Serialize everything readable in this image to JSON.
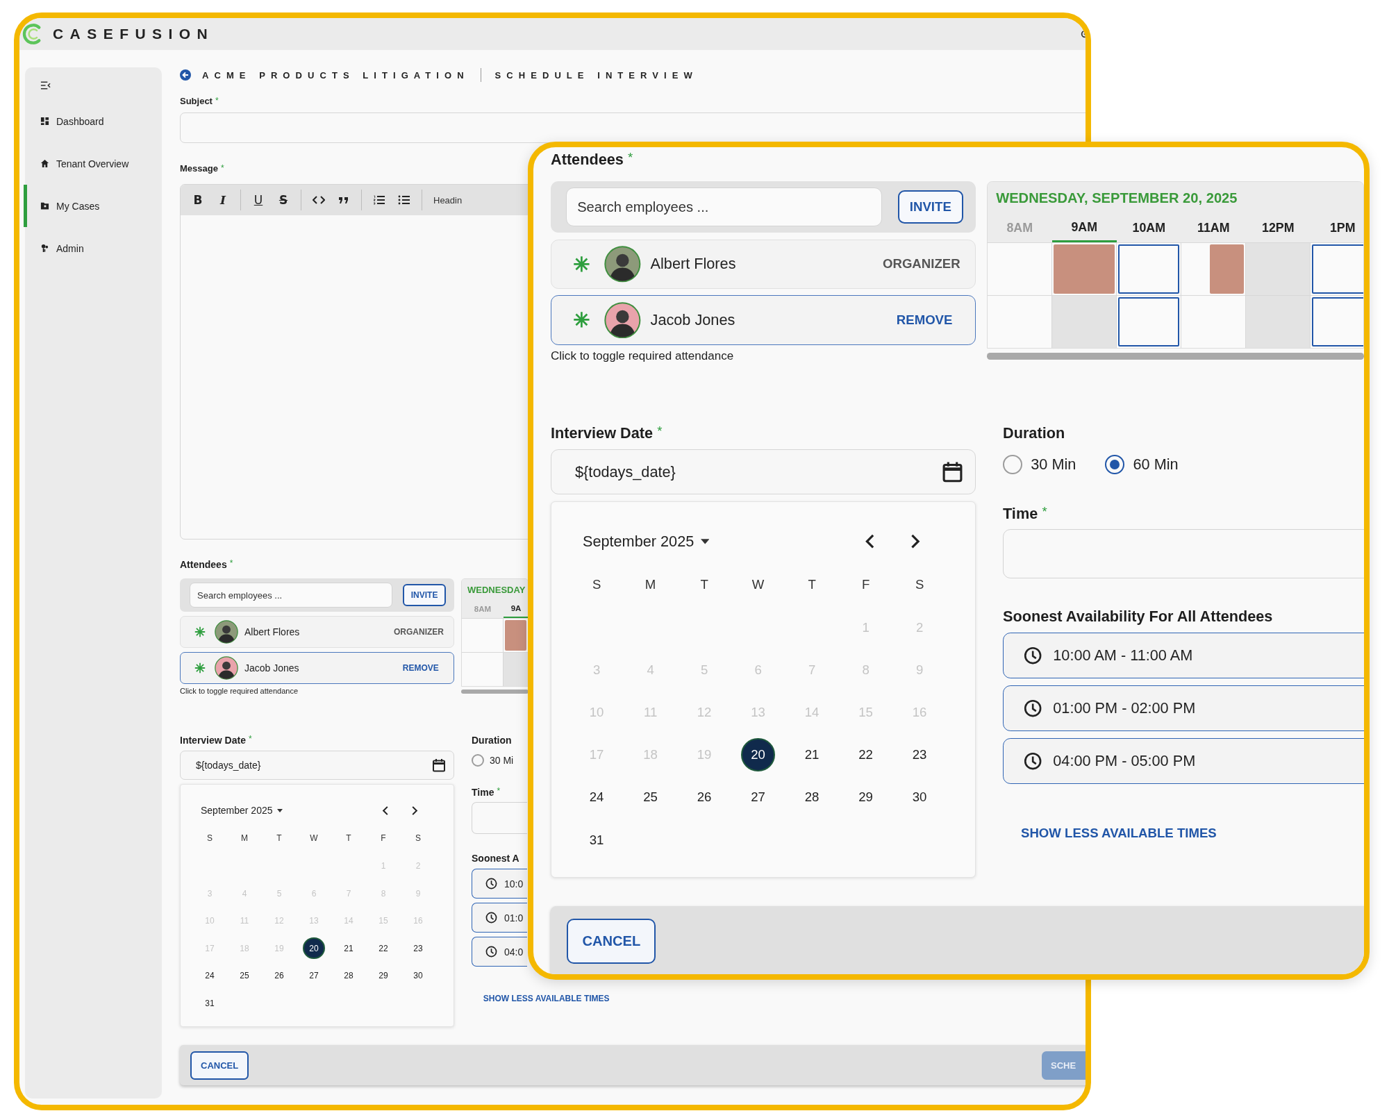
{
  "main_screen": {
    "brand": "CASEFUSION",
    "sidebar": {
      "items": [
        {
          "label": "Dashboard",
          "kind": "dashboard",
          "selected": false
        },
        {
          "label": "Tenant Overview",
          "kind": "home",
          "selected": false
        },
        {
          "label": "My Cases",
          "kind": "folder",
          "selected": true
        },
        {
          "label": "Admin",
          "kind": "admin",
          "selected": false
        }
      ]
    },
    "breadcrumb": [
      "ACME PRODUCTS LITIGATION",
      "SCHEDULE INTERVIEW"
    ],
    "subject": {
      "label": "Subject",
      "required_mark": "*"
    },
    "message": {
      "label": "Message",
      "required_mark": "*",
      "toolbar": [
        [
          {
            "kind": "bold",
            "label": "B"
          },
          {
            "kind": "italic",
            "label": "I"
          }
        ],
        [
          {
            "kind": "underline",
            "label": "U"
          },
          {
            "kind": "strike",
            "label": "S"
          }
        ],
        [
          {
            "kind": "code"
          },
          {
            "kind": "quote"
          }
        ],
        [
          {
            "kind": "ordered-list"
          },
          {
            "kind": "bullet-list"
          }
        ],
        [
          {
            "kind": "dropdown",
            "label": "Headin"
          }
        ]
      ]
    },
    "form": {
      "attendees": {
        "label": "Attendees",
        "required_mark": "*",
        "search_placeholder": "Search employees ...",
        "invite": "INVITE",
        "people": [
          {
            "name": "Albert Flores",
            "action": "ORGANIZER",
            "kind": "role",
            "required": true,
            "selected": false,
            "color": "#8d9a7a"
          },
          {
            "name": "Jacob Jones",
            "action": "REMOVE",
            "kind": "link",
            "required": true,
            "selected": true,
            "color": "#e9a3ab"
          }
        ],
        "hint": "Click to toggle required attendance"
      },
      "schedule": {
        "date": "WEDNESDAY",
        "hours": [
          {
            "label": "8AM",
            "muted": true,
            "selected": false
          },
          {
            "label": "9A",
            "muted": false,
            "selected": true
          }
        ],
        "rows": [
          [
            {
              "kind": "empty"
            },
            {
              "kind": "busy"
            }
          ],
          [
            {
              "kind": "empty"
            },
            {
              "kind": "unavailable"
            }
          ]
        ]
      },
      "date_field": {
        "label": "Interview Date",
        "required_mark": "*",
        "value": "${todays_date}"
      },
      "calendar": {
        "month": "September 2025",
        "weekdays": [
          "S",
          "M",
          "T",
          "W",
          "T",
          "F",
          "S"
        ],
        "weeks": [
          [
            {
              "label": "1",
              "disabled": true,
              "selected": false
            },
            {
              "label": "2",
              "disabled": true,
              "selected": false
            }
          ],
          [
            {
              "label": "3",
              "disabled": true,
              "selected": false
            },
            {
              "label": "4",
              "disabled": true,
              "selected": false
            },
            {
              "label": "5",
              "disabled": true,
              "selected": false
            },
            {
              "label": "6",
              "disabled": true,
              "selected": false
            },
            {
              "label": "7",
              "disabled": true,
              "selected": false
            },
            {
              "label": "8",
              "disabled": true,
              "selected": false
            },
            {
              "label": "9",
              "disabled": true,
              "selected": false
            }
          ],
          [
            {
              "label": "10",
              "disabled": true,
              "selected": false
            },
            {
              "label": "11",
              "disabled": true,
              "selected": false
            },
            {
              "label": "12",
              "disabled": true,
              "selected": false
            },
            {
              "label": "13",
              "disabled": true,
              "selected": false
            },
            {
              "label": "14",
              "disabled": true,
              "selected": false
            },
            {
              "label": "15",
              "disabled": true,
              "selected": false
            },
            {
              "label": "16",
              "disabled": true,
              "selected": false
            }
          ],
          [
            {
              "label": "17",
              "disabled": true,
              "selected": false
            },
            {
              "label": "18",
              "disabled": true,
              "selected": false
            },
            {
              "label": "19",
              "disabled": true,
              "selected": false
            },
            {
              "label": "20",
              "disabled": false,
              "selected": true
            },
            {
              "label": "21",
              "disabled": false,
              "selected": false
            },
            {
              "label": "22",
              "disabled": false,
              "selected": false
            },
            {
              "label": "23",
              "disabled": false,
              "selected": false
            }
          ],
          [
            {
              "label": "24",
              "disabled": false,
              "selected": false
            },
            {
              "label": "25",
              "disabled": false,
              "selected": false
            },
            {
              "label": "26",
              "disabled": false,
              "selected": false
            },
            {
              "label": "27",
              "disabled": false,
              "selected": false
            },
            {
              "label": "28",
              "disabled": false,
              "selected": false
            },
            {
              "label": "29",
              "disabled": false,
              "selected": false
            },
            {
              "label": "30",
              "disabled": false,
              "selected": false
            }
          ],
          [
            {
              "label": "31",
              "disabled": false,
              "selected": false
            }
          ]
        ]
      },
      "duration": {
        "label": "Duration",
        "options": [
          {
            "label": "30 Mi",
            "selected": false
          }
        ]
      },
      "time": {
        "label": "Time",
        "required_mark": "*"
      },
      "availability": {
        "label": "Soonest A",
        "slots": [
          "10:0",
          "01:0",
          "04:0"
        ],
        "toggle": "SHOW LESS AVAILABLE TIMES"
      }
    },
    "footer": {
      "buttons": [
        {
          "kind": "secondary",
          "label": "CANCEL"
        },
        {
          "kind": "primary",
          "label": "SCHE",
          "disabled": true
        }
      ]
    }
  },
  "zoom_callout": {
    "form": {
      "attendees": {
        "label": "Attendees",
        "required_mark": "*",
        "search_placeholder": "Search employees ...",
        "invite": "INVITE",
        "people": [
          {
            "name": "Albert Flores",
            "action": "ORGANIZER",
            "kind": "role",
            "required": true,
            "selected": false,
            "color": "#8d9a7a"
          },
          {
            "name": "Jacob Jones",
            "action": "REMOVE",
            "kind": "link",
            "required": true,
            "selected": true,
            "color": "#e9a3ab"
          }
        ],
        "hint": "Click to toggle required attendance"
      },
      "schedule": {
        "date": "WEDNESDAY, SEPTEMBER 20, 2025",
        "hours": [
          {
            "label": "8AM",
            "muted": true,
            "selected": false
          },
          {
            "label": "9AM",
            "muted": false,
            "selected": true
          },
          {
            "label": "10AM",
            "muted": false,
            "selected": false
          },
          {
            "label": "11AM",
            "muted": false,
            "selected": false
          },
          {
            "label": "12PM",
            "muted": false,
            "selected": false
          },
          {
            "label": "1PM",
            "muted": false,
            "selected": false
          }
        ],
        "rows": [
          [
            {
              "kind": "empty"
            },
            {
              "kind": "busy"
            },
            {
              "kind": "available"
            },
            {
              "kind": "busy-partial"
            },
            {
              "kind": "unavailable"
            },
            {
              "kind": "available"
            }
          ],
          [
            {
              "kind": "empty"
            },
            {
              "kind": "unavailable"
            },
            {
              "kind": "available"
            },
            {
              "kind": "empty"
            },
            {
              "kind": "unavailable"
            },
            {
              "kind": "available"
            }
          ]
        ]
      },
      "date_field": {
        "label": "Interview Date",
        "required_mark": "*",
        "value": "${todays_date}"
      },
      "calendar": {
        "month": "September 2025",
        "weekdays": [
          "S",
          "M",
          "T",
          "W",
          "T",
          "F",
          "S"
        ],
        "weeks": [
          [
            {
              "label": "1",
              "disabled": true,
              "selected": false
            },
            {
              "label": "2",
              "disabled": true,
              "selected": false
            }
          ],
          [
            {
              "label": "3",
              "disabled": true,
              "selected": false
            },
            {
              "label": "4",
              "disabled": true,
              "selected": false
            },
            {
              "label": "5",
              "disabled": true,
              "selected": false
            },
            {
              "label": "6",
              "disabled": true,
              "selected": false
            },
            {
              "label": "7",
              "disabled": true,
              "selected": false
            },
            {
              "label": "8",
              "disabled": true,
              "selected": false
            },
            {
              "label": "9",
              "disabled": true,
              "selected": false
            }
          ],
          [
            {
              "label": "10",
              "disabled": true,
              "selected": false
            },
            {
              "label": "11",
              "disabled": true,
              "selected": false
            },
            {
              "label": "12",
              "disabled": true,
              "selected": false
            },
            {
              "label": "13",
              "disabled": true,
              "selected": false
            },
            {
              "label": "14",
              "disabled": true,
              "selected": false
            },
            {
              "label": "15",
              "disabled": true,
              "selected": false
            },
            {
              "label": "16",
              "disabled": true,
              "selected": false
            }
          ],
          [
            {
              "label": "17",
              "disabled": true,
              "selected": false
            },
            {
              "label": "18",
              "disabled": true,
              "selected": false
            },
            {
              "label": "19",
              "disabled": true,
              "selected": false
            },
            {
              "label": "20",
              "disabled": false,
              "selected": true
            },
            {
              "label": "21",
              "disabled": false,
              "selected": false
            },
            {
              "label": "22",
              "disabled": false,
              "selected": false
            },
            {
              "label": "23",
              "disabled": false,
              "selected": false
            }
          ],
          [
            {
              "label": "24",
              "disabled": false,
              "selected": false
            },
            {
              "label": "25",
              "disabled": false,
              "selected": false
            },
            {
              "label": "26",
              "disabled": false,
              "selected": false
            },
            {
              "label": "27",
              "disabled": false,
              "selected": false
            },
            {
              "label": "28",
              "disabled": false,
              "selected": false
            },
            {
              "label": "29",
              "disabled": false,
              "selected": false
            },
            {
              "label": "30",
              "disabled": false,
              "selected": false
            }
          ],
          [
            {
              "label": "31",
              "disabled": false,
              "selected": false
            }
          ]
        ]
      },
      "duration": {
        "label": "Duration",
        "options": [
          {
            "label": "30 Min",
            "selected": false
          },
          {
            "label": "60 Min",
            "selected": true
          }
        ]
      },
      "time": {
        "label": "Time",
        "required_mark": "*"
      },
      "availability": {
        "label": "Soonest Availability For All Attendees",
        "slots": [
          "10:00 AM - 11:00 AM",
          "01:00 PM - 02:00 PM",
          "04:00 PM - 05:00 PM"
        ],
        "toggle": "SHOW LESS AVAILABLE TIMES"
      }
    },
    "footer": {
      "buttons": [
        {
          "kind": "secondary",
          "label": "CANCEL"
        }
      ]
    }
  }
}
